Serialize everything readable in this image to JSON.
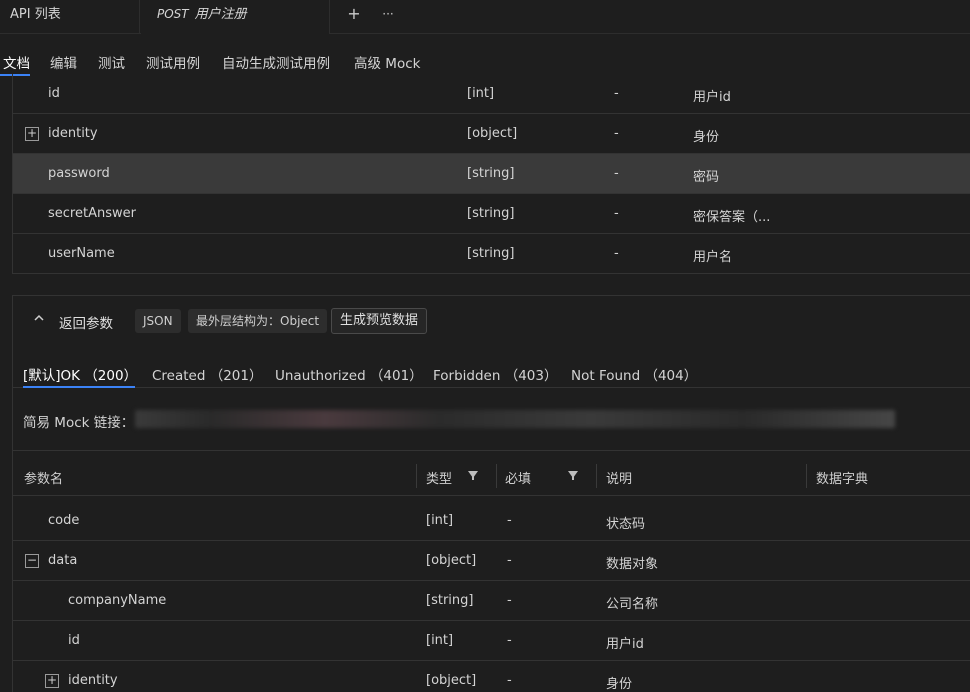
{
  "tabs": {
    "list_label": "API 列表",
    "active_method": "POST",
    "active_label": "用户注册",
    "add_label": "+",
    "more_label": "···"
  },
  "subnav": [
    "文档",
    "编辑",
    "测试",
    "测试用例",
    "自动生成测试用例",
    "高级 Mock"
  ],
  "request_rows": [
    {
      "name": "id",
      "type": "[int]",
      "required": "-",
      "desc": "用户id",
      "toggle": ""
    },
    {
      "name": "identity",
      "type": "[object]",
      "required": "-",
      "desc": "身份",
      "toggle": "+"
    },
    {
      "name": "password",
      "type": "[string]",
      "required": "-",
      "desc": "密码",
      "toggle": ""
    },
    {
      "name": "secretAnswer",
      "type": "[string]",
      "required": "-",
      "desc": "密保答案（...",
      "toggle": ""
    },
    {
      "name": "userName",
      "type": "[string]",
      "required": "-",
      "desc": "用户名",
      "toggle": ""
    }
  ],
  "response": {
    "collapse_icon": "chevron-up-icon",
    "title": "返回参数",
    "format_chip": "JSON",
    "structure_chip": "最外层结构为：Object",
    "preview_button": "生成预览数据",
    "status_tabs": [
      "[默认]OK （200）",
      "Created （201）",
      "Unauthorized （401）",
      "Forbidden （403）",
      "Not Found （404）"
    ],
    "mock_label": "简易 Mock 链接："
  },
  "resp_table": {
    "headers": [
      "参数名",
      "类型",
      "必填",
      "说明",
      "数据字典"
    ],
    "rows": [
      {
        "name": "code",
        "type": "[int]",
        "required": "-",
        "desc": "状态码",
        "toggle": "",
        "indent": 0
      },
      {
        "name": "data",
        "type": "[object]",
        "required": "-",
        "desc": "数据对象",
        "toggle": "−",
        "indent": 0
      },
      {
        "name": "companyName",
        "type": "[string]",
        "required": "-",
        "desc": "公司名称",
        "toggle": "",
        "indent": 1
      },
      {
        "name": "id",
        "type": "[int]",
        "required": "-",
        "desc": "用户id",
        "toggle": "",
        "indent": 1
      },
      {
        "name": "identity",
        "type": "[object]",
        "required": "-",
        "desc": "身份",
        "toggle": "+",
        "indent": 1
      }
    ]
  },
  "colors": {
    "accent": "#3b82f6",
    "highlight_row": "#3a3a3a"
  }
}
